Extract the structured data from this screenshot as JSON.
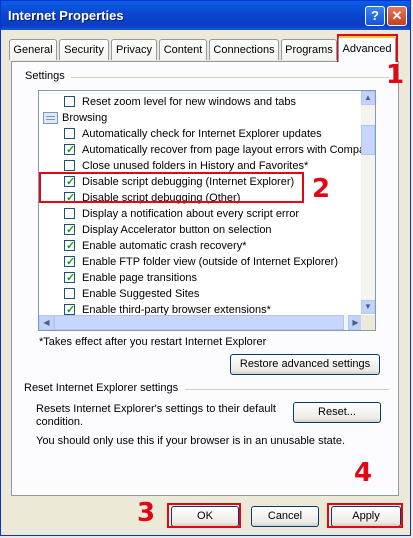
{
  "window": {
    "title": "Internet Properties",
    "help_label": "?",
    "close_label": "✕"
  },
  "tabs": [
    {
      "label": "General"
    },
    {
      "label": "Security"
    },
    {
      "label": "Privacy"
    },
    {
      "label": "Content"
    },
    {
      "label": "Connections"
    },
    {
      "label": "Programs"
    },
    {
      "label": "Advanced",
      "active": true
    }
  ],
  "settings": {
    "group_label": "Settings",
    "items": [
      {
        "type": "checkbox",
        "checked": false,
        "label": "Reset zoom level for new windows and tabs"
      },
      {
        "type": "category",
        "label": "Browsing",
        "icon": "folder-icon"
      },
      {
        "type": "checkbox",
        "checked": false,
        "label": "Automatically check for Internet Explorer updates"
      },
      {
        "type": "checkbox",
        "checked": true,
        "label": "Automatically recover from page layout errors with Compa"
      },
      {
        "type": "checkbox",
        "checked": false,
        "label": "Close unused folders in History and Favorites*"
      },
      {
        "type": "checkbox",
        "checked": true,
        "label": "Disable script debugging (Internet Explorer)"
      },
      {
        "type": "checkbox",
        "checked": true,
        "label": "Disable script debugging (Other)"
      },
      {
        "type": "checkbox",
        "checked": false,
        "label": "Display a notification about every script error"
      },
      {
        "type": "checkbox",
        "checked": true,
        "label": "Display Accelerator button on selection"
      },
      {
        "type": "checkbox",
        "checked": true,
        "label": "Enable automatic crash recovery*"
      },
      {
        "type": "checkbox",
        "checked": true,
        "label": "Enable FTP folder view (outside of Internet Explorer)"
      },
      {
        "type": "checkbox",
        "checked": true,
        "label": "Enable page transitions"
      },
      {
        "type": "checkbox",
        "checked": false,
        "label": "Enable Suggested Sites"
      },
      {
        "type": "checkbox",
        "checked": true,
        "label": "Enable third-party browser extensions*"
      }
    ],
    "footnote": "*Takes effect after you restart Internet Explorer",
    "restore_label": "Restore advanced settings"
  },
  "reset": {
    "group_label": "Reset Internet Explorer settings",
    "description": "Resets Internet Explorer's settings to their default condition.",
    "warning": "You should only use this if your browser is in an unusable state.",
    "button_label": "Reset..."
  },
  "footer": {
    "ok_label": "OK",
    "cancel_label": "Cancel",
    "apply_label": "Apply"
  },
  "annotations": {
    "n1": "1",
    "n2": "2",
    "n3": "3",
    "n4": "4",
    "color": "#e30613"
  },
  "colors": {
    "titlebar": "#0a4fd6",
    "dialog": "#ece9d8",
    "check": "#21a121"
  }
}
